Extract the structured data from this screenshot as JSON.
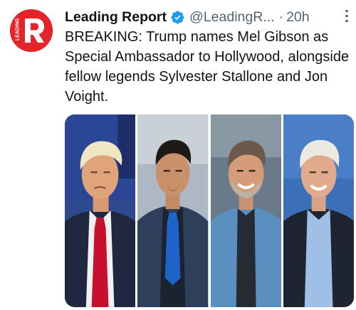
{
  "tweet": {
    "author_name": "Leading Report",
    "handle": "@LeadingR...",
    "separator": "·",
    "time": "20h",
    "avatar_text": "LEADING",
    "text": "BREAKING: Trump names Mel Gibson as Special Ambassador to Hollywood, alongside fellow legends Sylvester Stallone and Jon Voight."
  },
  "icons": {
    "verified": "verified-badge-icon",
    "more": "more-options-icon"
  },
  "colors": {
    "brand_red": "#e3242b",
    "verified_blue": "#1d9bf0",
    "text_primary": "#0f1419",
    "text_secondary": "#536471"
  },
  "media": {
    "photo_count": 4
  }
}
